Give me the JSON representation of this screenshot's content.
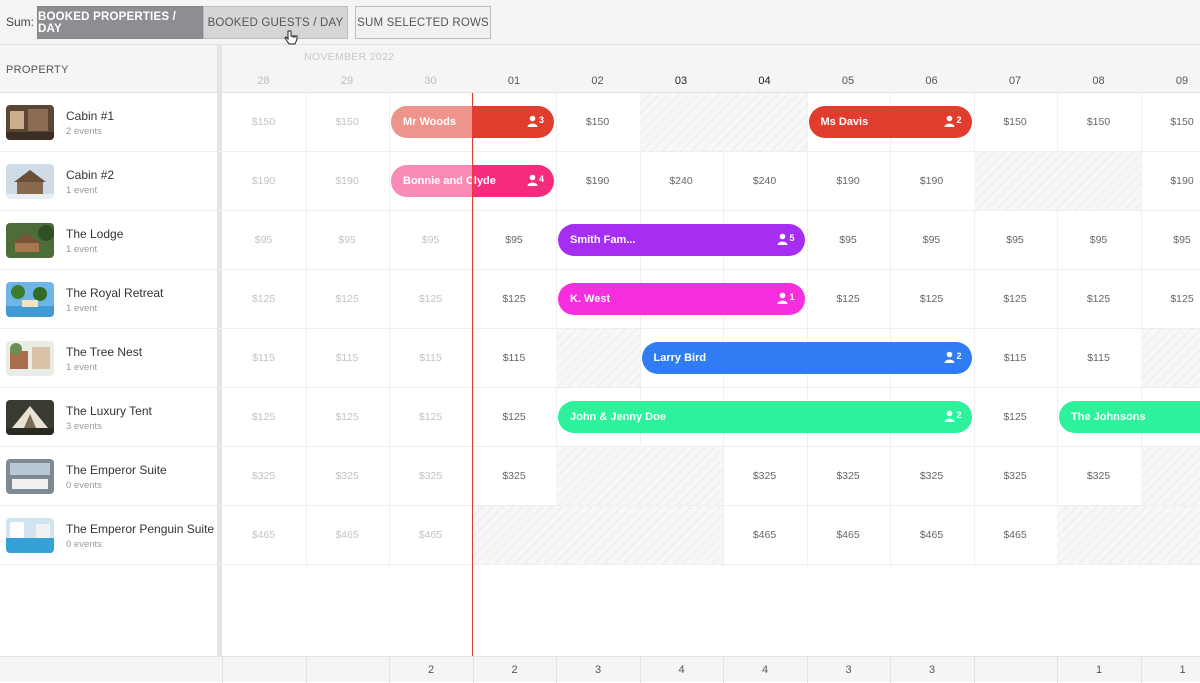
{
  "toolbar": {
    "sum_label": "Sum:",
    "buttons": [
      {
        "label": "BOOKED PROPERTIES / DAY",
        "state": "active"
      },
      {
        "label": "BOOKED GUESTS / DAY",
        "state": "inactive"
      },
      {
        "label": "SUM SELECTED ROWS",
        "state": "plain"
      }
    ]
  },
  "grid": {
    "property_header": "PROPERTY",
    "month_label": "NOVEMBER 2022",
    "days": [
      "28",
      "29",
      "30",
      "01",
      "02",
      "03",
      "04",
      "05",
      "06",
      "07",
      "08",
      "09"
    ],
    "today_index": 3
  },
  "properties": [
    {
      "name": "Cabin #1",
      "events": "2 events",
      "thumb": "cabin1",
      "prices": [
        "$150",
        "$150",
        "",
        "",
        "$150",
        "",
        "",
        "",
        "",
        "$150",
        "$150",
        "$150"
      ]
    },
    {
      "name": "Cabin #2",
      "events": "1 event",
      "thumb": "cabin2",
      "prices": [
        "$190",
        "$190",
        "",
        "",
        "$190",
        "$240",
        "$240",
        "$190",
        "$190",
        "",
        "",
        "$190"
      ]
    },
    {
      "name": "The Lodge",
      "events": "1 event",
      "thumb": "lodge",
      "prices": [
        "$95",
        "$95",
        "$95",
        "$95",
        "",
        "",
        "",
        "$95",
        "$95",
        "$95",
        "$95",
        "$95"
      ]
    },
    {
      "name": "The Royal Retreat",
      "events": "1 event",
      "thumb": "retreat",
      "prices": [
        "$125",
        "$125",
        "$125",
        "$125",
        "",
        "",
        "",
        "$125",
        "$125",
        "$125",
        "$125",
        "$125"
      ]
    },
    {
      "name": "The Tree Nest",
      "events": "1 event",
      "thumb": "treenest",
      "prices": [
        "$115",
        "$115",
        "$115",
        "$115",
        "",
        "",
        "",
        "",
        "",
        "$115",
        "$115",
        ""
      ]
    },
    {
      "name": "The Luxury Tent",
      "events": "3 events",
      "thumb": "tent",
      "prices": [
        "$125",
        "$125",
        "$125",
        "$125",
        "",
        "",
        "",
        "",
        "",
        "$125",
        "",
        ""
      ]
    },
    {
      "name": "The Emperor Suite",
      "events": "0 events",
      "thumb": "suite",
      "prices": [
        "$325",
        "$325",
        "$325",
        "$325",
        "",
        "",
        "$325",
        "$325",
        "$325",
        "$325",
        "$325",
        ""
      ]
    },
    {
      "name": "The Emperor Penguin Suite",
      "events": "0 events",
      "thumb": "penguin",
      "prices": [
        "$465",
        "$465",
        "$465",
        "",
        "",
        "",
        "$465",
        "$465",
        "$465",
        "$465",
        "",
        ""
      ]
    }
  ],
  "blocked": [
    {
      "row": 0,
      "start": 5,
      "span": 2
    },
    {
      "row": 1,
      "start": 9,
      "span": 2
    },
    {
      "row": 4,
      "start": 4,
      "span": 1
    },
    {
      "row": 4,
      "start": 11,
      "span": 1
    },
    {
      "row": 6,
      "start": 4,
      "span": 2
    },
    {
      "row": 6,
      "start": 11,
      "span": 1
    },
    {
      "row": 7,
      "start": 3,
      "span": 3
    },
    {
      "row": 7,
      "start": 10,
      "span": 2
    }
  ],
  "bookings": [
    {
      "row": 0,
      "start": 2.0,
      "end": 4.0,
      "name": "Mr Woods",
      "guests": "3",
      "color": "#e13d2f"
    },
    {
      "row": 0,
      "start": 7.0,
      "end": 9.0,
      "name": "Ms Davis",
      "guests": "2",
      "color": "#e13d2f"
    },
    {
      "row": 1,
      "start": 2.0,
      "end": 4.0,
      "name": "Bonnie and Clyde",
      "guests": "4",
      "color": "#f52c7d"
    },
    {
      "row": 2,
      "start": 4.0,
      "end": 7.0,
      "name": "Smith Fam...",
      "guests": "5",
      "color": "#a52ef0"
    },
    {
      "row": 3,
      "start": 4.0,
      "end": 7.0,
      "name": "K. West",
      "guests": "1",
      "color": "#f52ee0"
    },
    {
      "row": 4,
      "start": 5.0,
      "end": 9.0,
      "name": "Larry Bird",
      "guests": "2",
      "color": "#2f7cf3"
    },
    {
      "row": 5,
      "start": 4.0,
      "end": 9.0,
      "name": "John & Jenny Doe",
      "guests": "2",
      "color": "#2ef19c"
    },
    {
      "row": 5,
      "start": 10.0,
      "end": 12.2,
      "name": "The Johnsons",
      "guests": "",
      "color": "#2ef19c"
    }
  ],
  "footer": {
    "sums": [
      "",
      "",
      "2",
      "2",
      "3",
      "4",
      "4",
      "3",
      "3",
      "",
      "1",
      "1"
    ]
  }
}
